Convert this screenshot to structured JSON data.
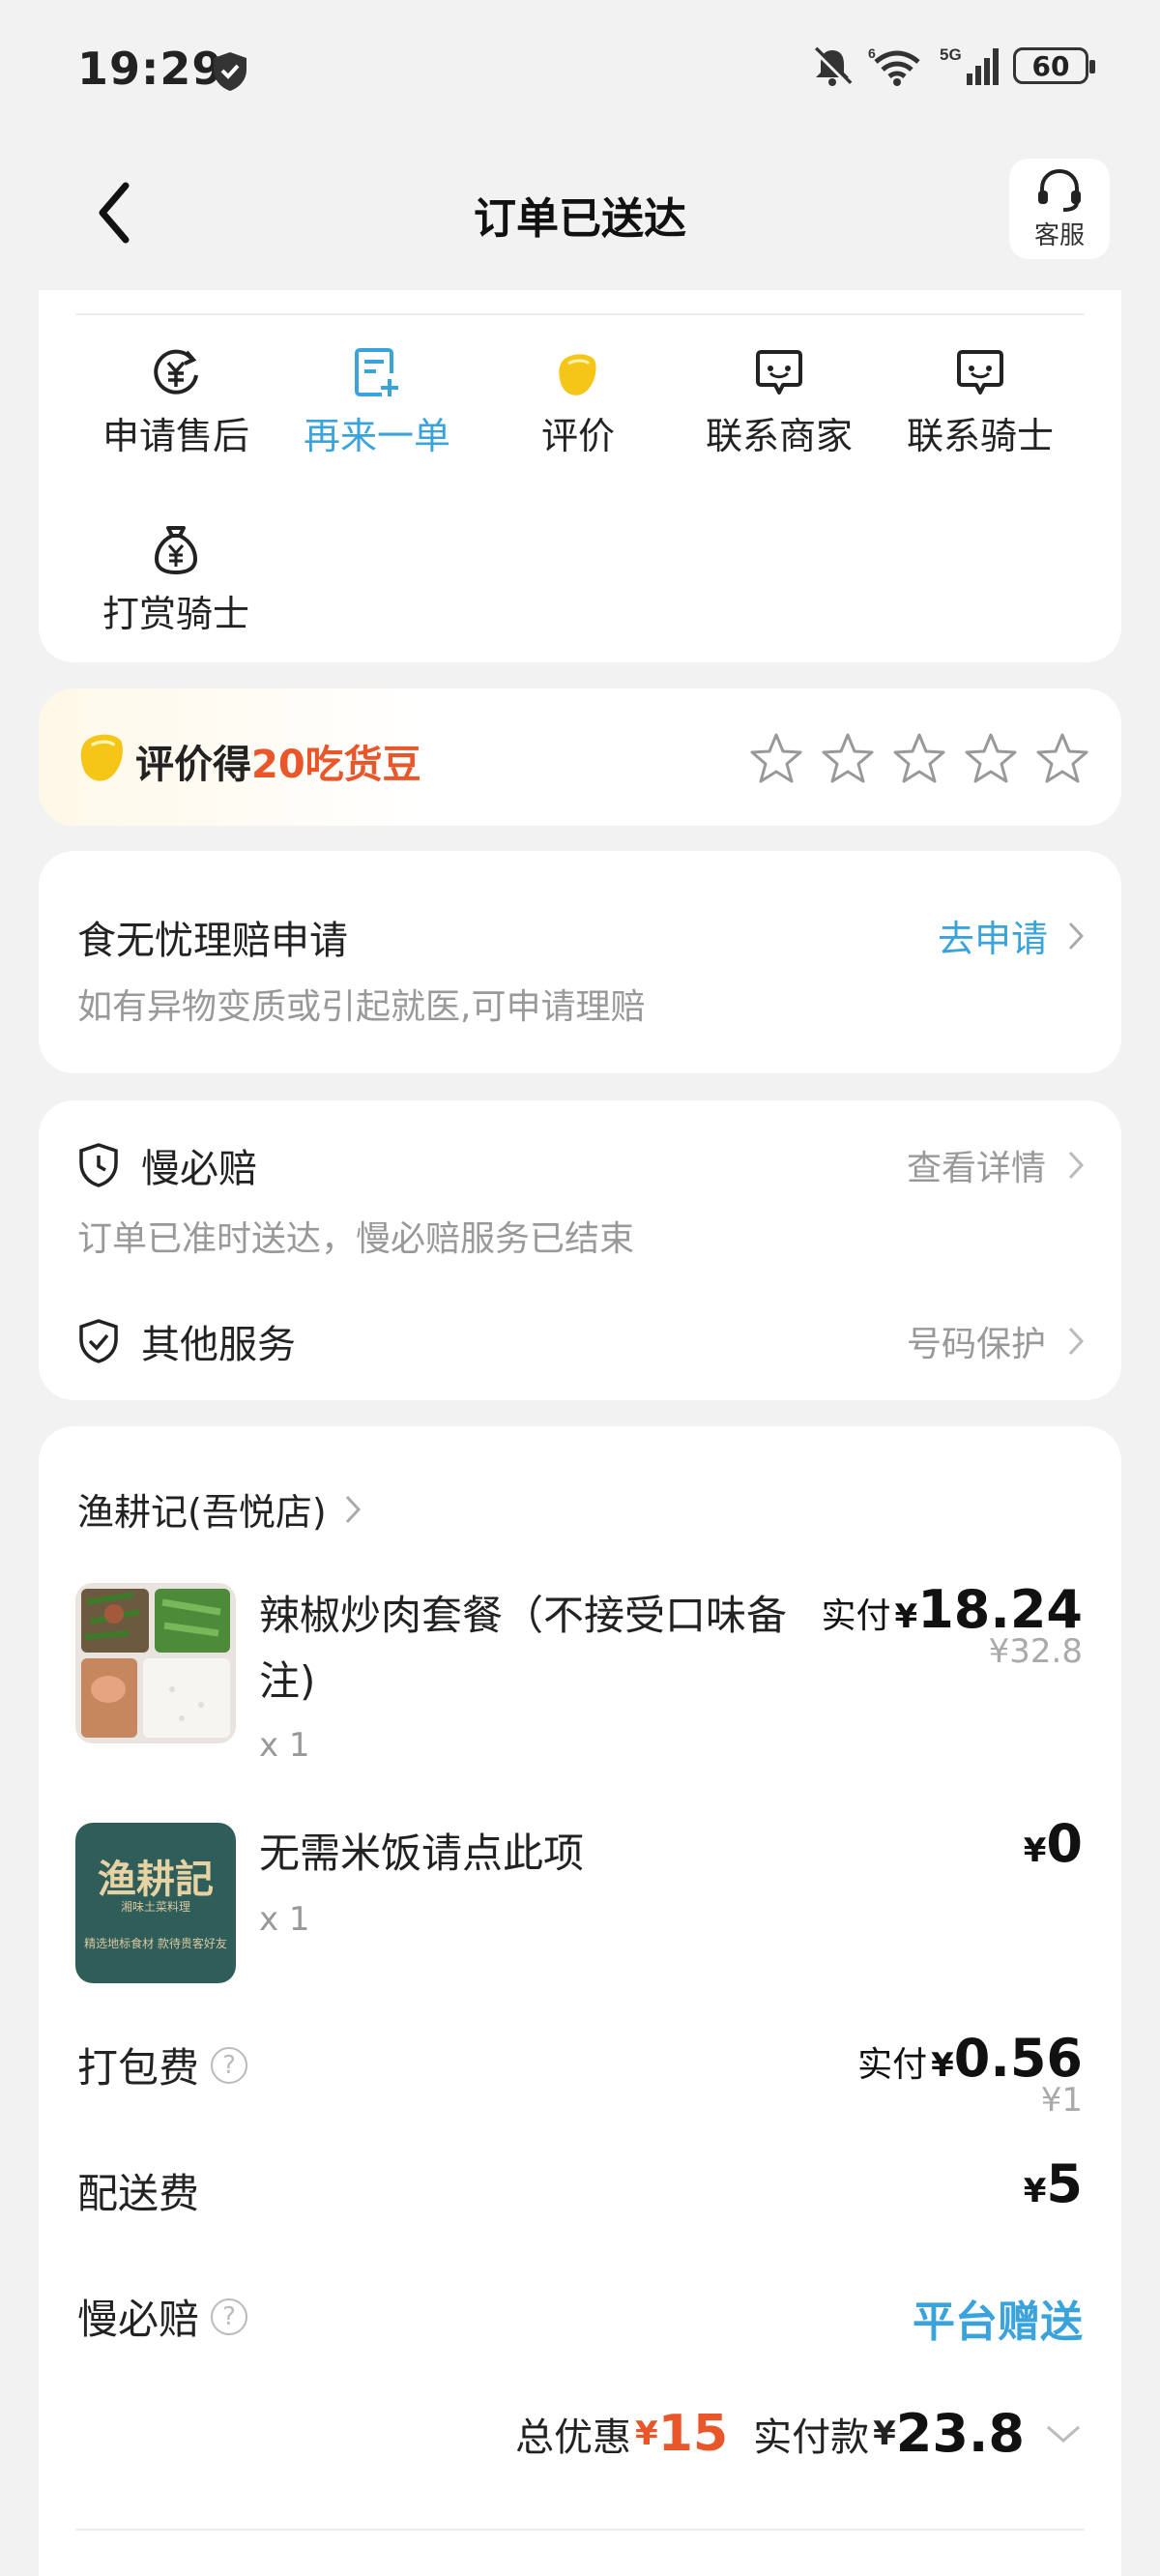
{
  "status_bar": {
    "time": "19:29",
    "battery": "60"
  },
  "nav": {
    "title": "订单已送达",
    "service_label": "客服"
  },
  "actions": [
    {
      "label": "申请售后",
      "icon": "yuan-refresh-icon"
    },
    {
      "label": "再来一单",
      "icon": "reorder-icon"
    },
    {
      "label": "评价",
      "icon": "bean-icon"
    },
    {
      "label": "联系商家",
      "icon": "chat-icon"
    },
    {
      "label": "联系骑士",
      "icon": "chat-icon"
    },
    {
      "label": "打赏骑士",
      "icon": "money-bag-icon"
    }
  ],
  "review": {
    "prefix": "评价得",
    "highlight": "20吃货豆",
    "stars_filled": 0,
    "stars_total": 5
  },
  "claim": {
    "title": "食无忧理赔申请",
    "link": "去申请",
    "subtitle": "如有异物变质或引起就医,可申请理赔"
  },
  "services": {
    "slow_title": "慢必赔",
    "slow_link": "查看详情",
    "slow_sub": "订单已准时送达，慢必赔服务已结束",
    "other_title": "其他服务",
    "other_link": "号码保护"
  },
  "order": {
    "shop": "渔耕记(吾悦店)",
    "items": [
      {
        "name": "辣椒炒肉套餐（不接受口味备注)",
        "qty": "x 1",
        "paid_label": "实付",
        "currency": "¥",
        "price": "18.24",
        "original": "¥32.8"
      },
      {
        "name": "无需米饭请点此项",
        "qty": "x 1",
        "currency": "¥",
        "price": "0",
        "logo_text": "渔耕記",
        "logo_sub1": "湘味土菜料理",
        "logo_sub2": "精选地标食材 款待贵客好友"
      }
    ],
    "packing": {
      "label": "打包费",
      "paid_label": "实付",
      "currency": "¥",
      "price": "0.56",
      "original": "¥1"
    },
    "delivery": {
      "label": "配送费",
      "currency": "¥",
      "price": "5"
    },
    "slow_pay": {
      "label": "慢必赔",
      "value": "平台赠送"
    },
    "total": {
      "discount_label": "总优惠",
      "discount_currency": "¥",
      "discount": "15",
      "paid_label": "实付款",
      "paid_currency": "¥",
      "paid": "23.8"
    }
  },
  "colors": {
    "accent_blue": "#3ba3dc",
    "accent_red": "#e8562a",
    "bean_yellow": "#f5c518"
  }
}
